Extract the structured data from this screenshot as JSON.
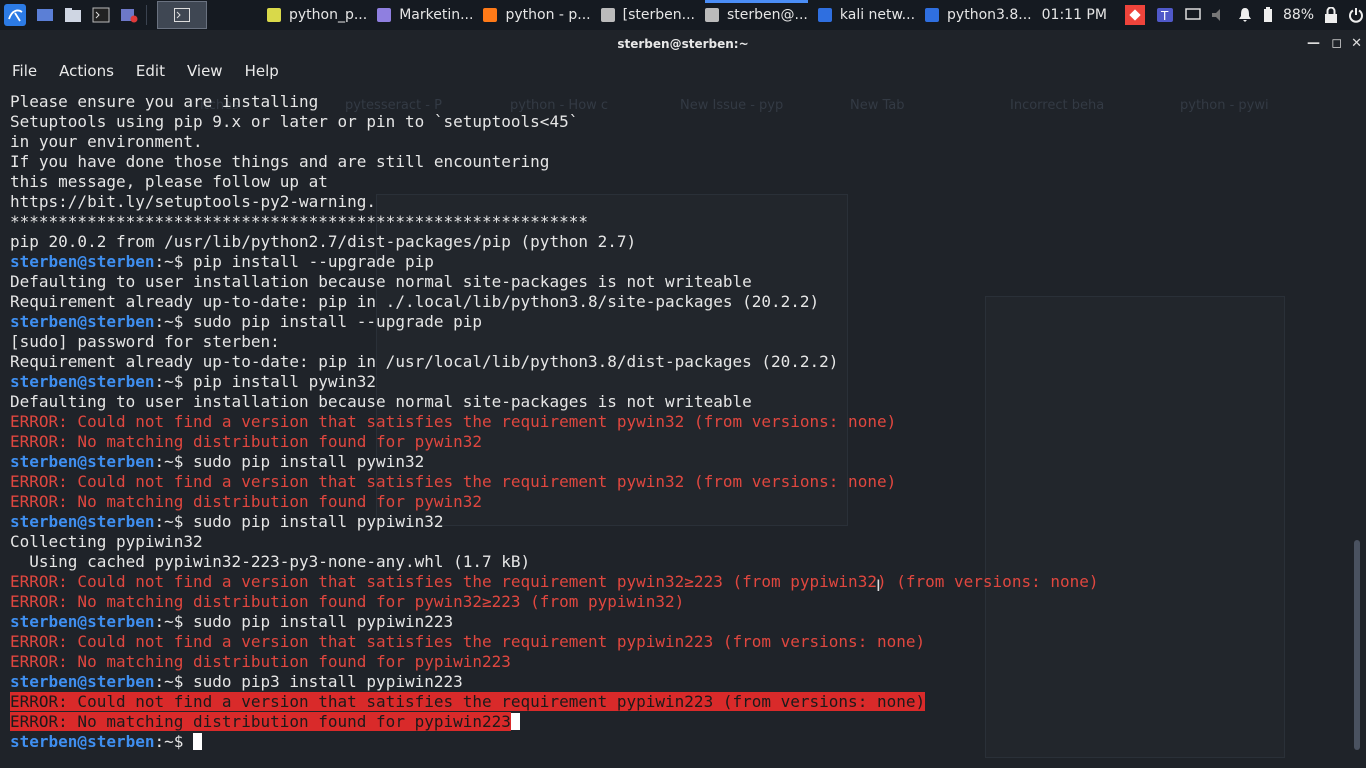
{
  "panel": {
    "tasks": [
      {
        "label": "python_p...",
        "icon": "document-icon",
        "color": "#d9d94a"
      },
      {
        "label": "Marketin...",
        "icon": "app-icon",
        "color": "#8f7fe0"
      },
      {
        "label": "python - p...",
        "icon": "firefox-icon",
        "color": "#ff7a18"
      },
      {
        "label": "[sterben...",
        "icon": "terminal-icon",
        "color": "#bbbbbb"
      },
      {
        "label": "sterben@...",
        "icon": "terminal-icon",
        "color": "#bbbbbb"
      },
      {
        "label": "kali netw...",
        "icon": "folder-icon",
        "color": "#2f6fe0"
      },
      {
        "label": "python3.8...",
        "icon": "folder-icon",
        "color": "#2f6fe0"
      }
    ],
    "clock": "01:11 PM",
    "battery": "88%"
  },
  "window": {
    "title": "sterben@sterben:~",
    "menu": [
      "File",
      "Actions",
      "Edit",
      "View",
      "Help"
    ]
  },
  "ghost": {
    "tabs": [
      "itches",
      "pytesseract - P",
      "python - How c",
      "New Issue - pyp",
      "New Tab",
      "Incorrect beha",
      "python - pywi"
    ]
  },
  "terminal": {
    "lines": [
      {
        "type": "out",
        "text": "Please ensure you are installing"
      },
      {
        "type": "out",
        "text": "Setuptools using pip 9.x or later or pin to `setuptools<45`"
      },
      {
        "type": "out",
        "text": "in your environment."
      },
      {
        "type": "out",
        "text": "If you have done those things and are still encountering"
      },
      {
        "type": "out",
        "text": "this message, please follow up at"
      },
      {
        "type": "out",
        "text": "https://bit.ly/setuptools-py2-warning."
      },
      {
        "type": "out",
        "text": "************************************************************"
      },
      {
        "type": "out",
        "text": "pip 20.0.2 from /usr/lib/python2.7/dist-packages/pip (python 2.7)"
      },
      {
        "type": "cmd",
        "prompt": "sterben@sterben",
        "path": ":~$ ",
        "text": "pip install --upgrade pip"
      },
      {
        "type": "out",
        "text": "Defaulting to user installation because normal site-packages is not writeable"
      },
      {
        "type": "out",
        "text": "Requirement already up-to-date: pip in ./.local/lib/python3.8/site-packages (20.2.2)"
      },
      {
        "type": "cmd",
        "prompt": "sterben@sterben",
        "path": ":~$ ",
        "text": "sudo pip install --upgrade pip"
      },
      {
        "type": "out",
        "text": "[sudo] password for sterben:"
      },
      {
        "type": "out",
        "text": "Requirement already up-to-date: pip in /usr/local/lib/python3.8/dist-packages (20.2.2)"
      },
      {
        "type": "cmd",
        "prompt": "sterben@sterben",
        "path": ":~$ ",
        "text": "pip install pywin32"
      },
      {
        "type": "out",
        "text": "Defaulting to user installation because normal site-packages is not writeable"
      },
      {
        "type": "err",
        "text": "ERROR: Could not find a version that satisfies the requirement pywin32 (from versions: none)"
      },
      {
        "type": "err",
        "text": "ERROR: No matching distribution found for pywin32"
      },
      {
        "type": "cmd",
        "prompt": "sterben@sterben",
        "path": ":~$ ",
        "text": "sudo pip install pywin32"
      },
      {
        "type": "err",
        "text": "ERROR: Could not find a version that satisfies the requirement pywin32 (from versions: none)"
      },
      {
        "type": "err",
        "text": "ERROR: No matching distribution found for pywin32"
      },
      {
        "type": "cmd",
        "prompt": "sterben@sterben",
        "path": ":~$ ",
        "text": "sudo pip install pypiwin32"
      },
      {
        "type": "out",
        "text": "Collecting pypiwin32"
      },
      {
        "type": "out",
        "text": "  Using cached pypiwin32-223-py3-none-any.whl (1.7 kB)"
      },
      {
        "type": "err",
        "text": "ERROR: Could not find a version that satisfies the requirement pywin32≥223 (from pypiwin32) (from versions: none)"
      },
      {
        "type": "err",
        "text": "ERROR: No matching distribution found for pywin32≥223 (from pypiwin32)"
      },
      {
        "type": "cmd",
        "prompt": "sterben@sterben",
        "path": ":~$ ",
        "text": "sudo pip install pypiwin223"
      },
      {
        "type": "err",
        "text": "ERROR: Could not find a version that satisfies the requirement pypiwin223 (from versions: none)"
      },
      {
        "type": "err",
        "text": "ERROR: No matching distribution found for pypiwin223"
      },
      {
        "type": "cmd",
        "prompt": "sterben@sterben",
        "path": ":~$ ",
        "text": "sudo pip3 install pypiwin223"
      },
      {
        "type": "hlerr",
        "text": "ERROR: Could not find a version that satisfies the requirement pypiwin223 (from versions: none)"
      },
      {
        "type": "hlerr",
        "text": "ERROR: No matching distribution found for pypiwin223",
        "cursor": true
      },
      {
        "type": "cmd",
        "prompt": "sterben@sterben",
        "path": ":~$ ",
        "text": "",
        "cursor": true
      }
    ]
  },
  "colors": {
    "prompt": "#3f8ff0",
    "error": "#e0473f",
    "highlight": "#d92a2a",
    "background": "#1f2329"
  }
}
